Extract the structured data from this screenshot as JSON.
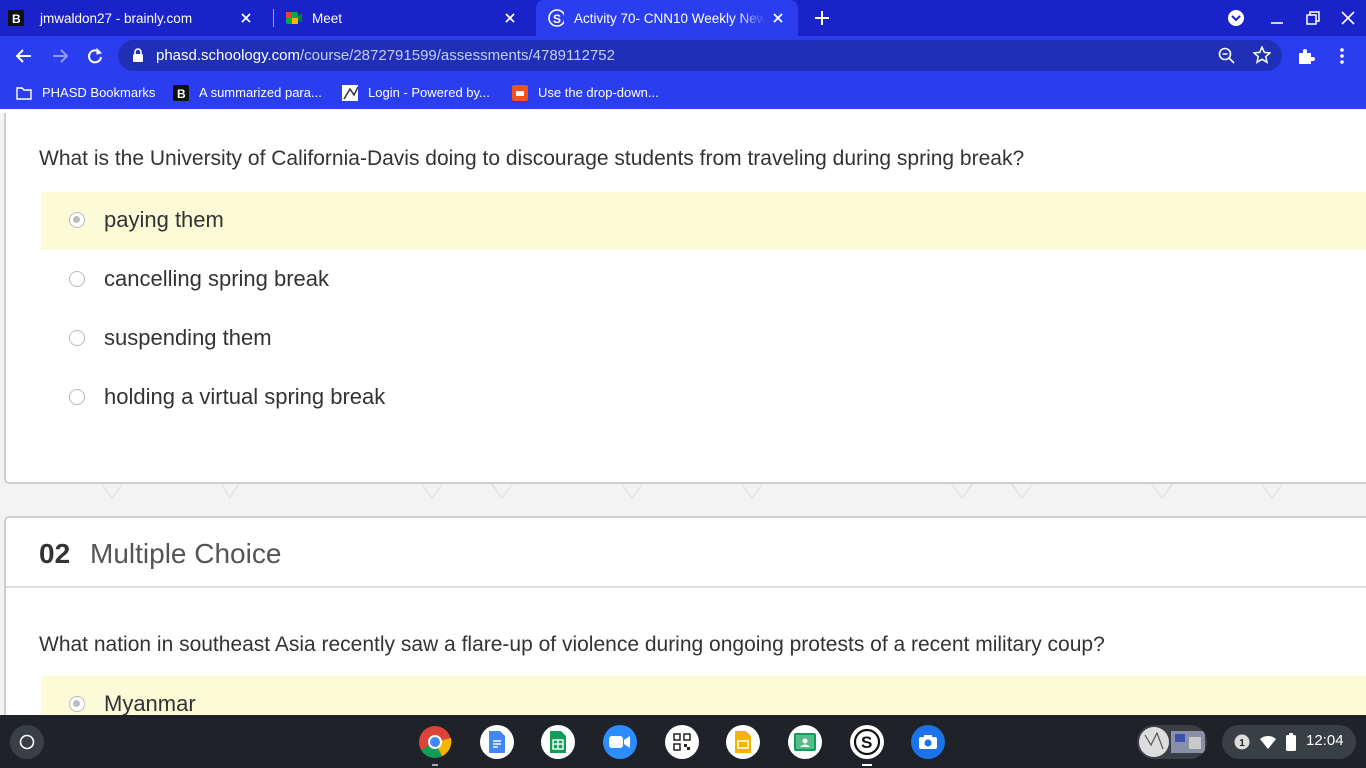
{
  "browser": {
    "tabs": [
      {
        "title": "jmwaldon27 - brainly.com",
        "favicon": "brainly-b-icon"
      },
      {
        "title": "Meet",
        "favicon": "google-meet-icon"
      },
      {
        "title": "Activity 70- CNN10 Weekly News",
        "favicon": "schoology-s-icon",
        "active": true
      }
    ],
    "url_host": "phasd.schoology.com",
    "url_path": "/course/2872791599/assessments/4789112752",
    "bookmarks": [
      {
        "label": "PHASD Bookmarks",
        "icon": "folder-icon"
      },
      {
        "label": "A summarized para...",
        "icon": "brainly-b-icon"
      },
      {
        "label": "Login - Powered by...",
        "icon": "login-site-icon"
      },
      {
        "label": "Use the drop-down...",
        "icon": "slides-icon"
      }
    ],
    "colors": {
      "chrome": "#2a3ef0",
      "tabstrip": "#1a22c9"
    }
  },
  "question1": {
    "text": "What is the University of California-Davis doing to discourage students from traveling during spring break?",
    "choices": [
      {
        "label": "paying them",
        "selected": true
      },
      {
        "label": "cancelling spring break",
        "selected": false
      },
      {
        "label": "suspending them",
        "selected": false
      },
      {
        "label": "holding a virtual spring break",
        "selected": false
      }
    ]
  },
  "question2": {
    "number": "02",
    "type": "Multiple Choice",
    "text": "What nation in southeast Asia recently saw a flare-up of violence during ongoing protests of a recent military coup?",
    "choices": [
      {
        "label": "Myanmar",
        "selected": true
      }
    ]
  },
  "shelf": {
    "apps": [
      "chrome-icon",
      "google-docs-icon",
      "google-sheets-icon",
      "zoom-icon",
      "qr-code-icon",
      "google-slides-icon",
      "google-classroom-icon",
      "schoology-icon",
      "camera-icon"
    ],
    "notification_count": "1",
    "time": "12:04"
  }
}
